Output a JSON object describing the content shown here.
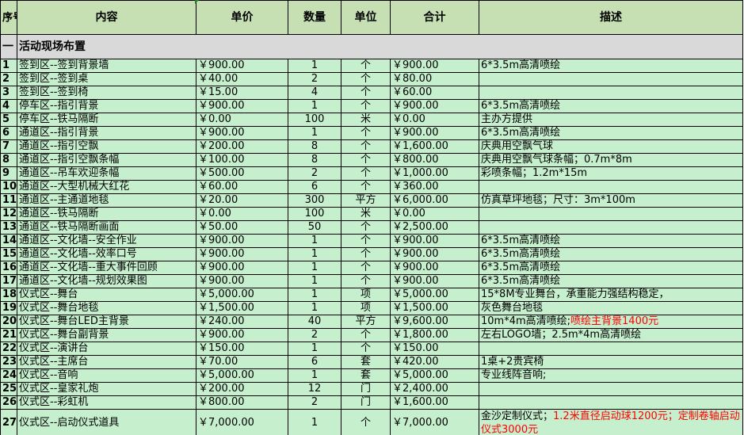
{
  "headers": {
    "seq": "序号",
    "content": "内容",
    "unit_price": "单价",
    "quantity": "数量",
    "unit": "单位",
    "total": "合计",
    "description": "描述"
  },
  "section": {
    "seq": "一",
    "title": "活动现场布置"
  },
  "rows": [
    {
      "seq": "1",
      "content": "签到区--签到背景墙",
      "price": "￥900.00",
      "qty": "1",
      "unit": "个",
      "total": "￥900.00",
      "desc": "6*3.5m高清喷绘",
      "desc_red": ""
    },
    {
      "seq": "2",
      "content": "签到区--签到桌",
      "price": "￥40.00",
      "qty": "2",
      "unit": "个",
      "total": "￥80.00",
      "desc": "",
      "desc_red": ""
    },
    {
      "seq": "3",
      "content": "签到区--签到椅",
      "price": "￥15.00",
      "qty": "4",
      "unit": "个",
      "total": "￥60.00",
      "desc": "",
      "desc_red": ""
    },
    {
      "seq": "4",
      "content": "停车区--指引背景",
      "price": "￥900.00",
      "qty": "1",
      "unit": "个",
      "total": "￥900.00",
      "desc": "6*3.5m高清喷绘",
      "desc_red": ""
    },
    {
      "seq": "5",
      "content": "停车区--铁马隔断",
      "price": "￥0.00",
      "qty": "100",
      "unit": "米",
      "total": "￥0.00",
      "desc": "主办方提供",
      "desc_red": ""
    },
    {
      "seq": "6",
      "content": "通道区--指引背景",
      "price": "￥900.00",
      "qty": "1",
      "unit": "个",
      "total": "￥900.00",
      "desc": "6*3.5m高清喷绘",
      "desc_red": ""
    },
    {
      "seq": "7",
      "content": "通道区--指引空飘",
      "price": "￥200.00",
      "qty": "8",
      "unit": "个",
      "total": "￥1,600.00",
      "desc": "庆典用空飘气球",
      "desc_red": ""
    },
    {
      "seq": "8",
      "content": "通道区--指引空飘条幅",
      "price": "￥100.00",
      "qty": "8",
      "unit": "个",
      "total": "￥800.00",
      "desc": "庆典用空飘气球条幅；0.7m*8m",
      "desc_red": ""
    },
    {
      "seq": "9",
      "content": "通道区--吊车欢迎条幅",
      "price": "￥500.00",
      "qty": "2",
      "unit": "个",
      "total": "￥1,000.00",
      "desc": "彩喷条幅；1.2m*15m",
      "desc_red": ""
    },
    {
      "seq": "10",
      "content": "通道区--大型机械大红花",
      "price": "￥60.00",
      "qty": "6",
      "unit": "个",
      "total": "￥360.00",
      "desc": "",
      "desc_red": ""
    },
    {
      "seq": "11",
      "content": "通道区--主通道地毯",
      "price": "￥20.00",
      "qty": "300",
      "unit": "平方",
      "total": "￥6,000.00",
      "desc": "仿真草坪地毯；尺寸：3m*100m",
      "desc_red": ""
    },
    {
      "seq": "12",
      "content": "通道区--铁马隔断",
      "price": "￥0.00",
      "qty": "100",
      "unit": "米",
      "total": "￥0.00",
      "desc": "",
      "desc_red": ""
    },
    {
      "seq": "13",
      "content": "通道区--铁马隔断画面",
      "price": "￥50.00",
      "qty": "50",
      "unit": "个",
      "total": "￥2,500.00",
      "desc": "",
      "desc_red": ""
    },
    {
      "seq": "14",
      "content": "通道区--文化墙--安全作业",
      "price": "￥900.00",
      "qty": "1",
      "unit": "个",
      "total": "￥900.00",
      "desc": "6*3.5m高清喷绘",
      "desc_red": ""
    },
    {
      "seq": "15",
      "content": "通道区--文化墙--效率口号",
      "price": "￥900.00",
      "qty": "1",
      "unit": "个",
      "total": "￥900.00",
      "desc": "6*3.5m高清喷绘",
      "desc_red": ""
    },
    {
      "seq": "16",
      "content": "通道区--文化墙--重大事件回顾",
      "price": "￥900.00",
      "qty": "1",
      "unit": "个",
      "total": "￥900.00",
      "desc": "6*3.5m高清喷绘",
      "desc_red": ""
    },
    {
      "seq": "17",
      "content": "通道区--文化墙--规划效果图",
      "price": "￥900.00",
      "qty": "1",
      "unit": "个",
      "total": "￥900.00",
      "desc": "6*3.5m高清喷绘",
      "desc_red": ""
    },
    {
      "seq": "18",
      "content": "仪式区--舞台",
      "price": "￥5,000.00",
      "qty": "1",
      "unit": "项",
      "total": "￥5,000.00",
      "desc": "15*8M专业舞台，承重能力强结构稳定，",
      "desc_red": ""
    },
    {
      "seq": "19",
      "content": "仪式区--舞台地毯",
      "price": "￥1,500.00",
      "qty": "1",
      "unit": "项",
      "total": "￥1,500.00",
      "desc": "灰色舞台地毯",
      "desc_red": ""
    },
    {
      "seq": "20",
      "content": "仪式区--舞台LED主背景",
      "price": "￥240.00",
      "qty": "40",
      "unit": "平方",
      "total": "￥9,600.00",
      "desc": "10m*4m高清喷绘;",
      "desc_red": "喷绘主背景1400元"
    },
    {
      "seq": "21",
      "content": "仪式区--舞台副背景",
      "price": "￥900.00",
      "qty": "2",
      "unit": "个",
      "total": "￥1,800.00",
      "desc": "左右LOGO墙；2.5m*4m高清喷绘",
      "desc_red": ""
    },
    {
      "seq": "22",
      "content": "仪式区--演讲台",
      "price": "￥150.00",
      "qty": "1",
      "unit": "个",
      "total": "￥150.00",
      "desc": "",
      "desc_red": ""
    },
    {
      "seq": "23",
      "content": "仪式区--主席台",
      "price": "￥70.00",
      "qty": "6",
      "unit": "套",
      "total": "￥420.00",
      "desc": "1桌+2贵宾椅",
      "desc_red": ""
    },
    {
      "seq": "24",
      "content": "仪式区--音响",
      "price": "￥5,000.00",
      "qty": "1",
      "unit": "套",
      "total": "￥5,000.00",
      "desc": "专业线阵音响;",
      "desc_red": ""
    },
    {
      "seq": "25",
      "content": "仪式区--皇家礼炮",
      "price": "￥200.00",
      "qty": "12",
      "unit": "门",
      "total": "￥2,400.00",
      "desc": "",
      "desc_red": ""
    },
    {
      "seq": "26",
      "content": "仪式区--彩虹机",
      "price": "￥800.00",
      "qty": "2",
      "unit": "门",
      "total": "￥1,600.00",
      "desc": "",
      "desc_red": ""
    }
  ],
  "last_row": {
    "seq": "27",
    "content": "仪式区--启动仪式道具",
    "price": "￥7,000.00",
    "qty": "1",
    "unit": "个",
    "total": "￥7,000.00",
    "desc": "金沙定制仪式；",
    "desc_red": "1.2米直径启动球1200元；定制卷轴启动仪式3000元"
  }
}
